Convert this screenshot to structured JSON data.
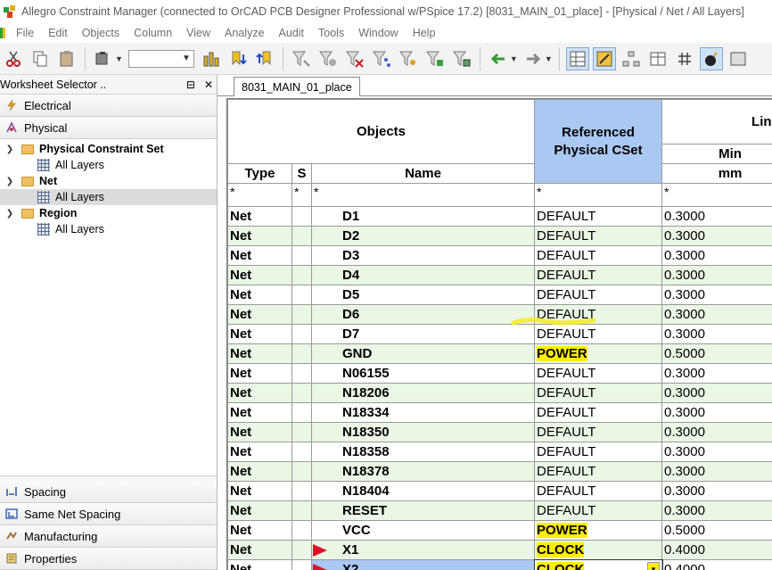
{
  "window": {
    "title": "Allegro Constraint Manager (connected to OrCAD PCB Designer Professional w/PSpice 17.2) [8031_MAIN_01_place] - [Physical / Net / All Layers]"
  },
  "menu": [
    "File",
    "Edit",
    "Objects",
    "Column",
    "View",
    "Analyze",
    "Audit",
    "Tools",
    "Window",
    "Help"
  ],
  "worksheet_selector": {
    "title": "Worksheet Selector ..",
    "pin_glyph": "⊟",
    "close_glyph": "✕",
    "top_categories": [
      {
        "label": "Electrical",
        "icon": "lightning-icon"
      },
      {
        "label": "Physical",
        "icon": "physical-icon"
      }
    ],
    "tree": [
      {
        "label": "Physical Constraint Set",
        "type": "folder",
        "level": 0
      },
      {
        "label": "All Layers",
        "type": "worksheet",
        "level": 1
      },
      {
        "label": "Net",
        "type": "folder",
        "level": 0
      },
      {
        "label": "All Layers",
        "type": "worksheet",
        "level": 1,
        "selected": true
      },
      {
        "label": "Region",
        "type": "folder",
        "level": 0
      },
      {
        "label": "All Layers",
        "type": "worksheet",
        "level": 1
      }
    ],
    "bottom_categories": [
      {
        "label": "Spacing",
        "icon": "spacing-icon"
      },
      {
        "label": "Same Net Spacing",
        "icon": "same-net-spacing-icon"
      },
      {
        "label": "Manufacturing",
        "icon": "manufacturing-icon"
      },
      {
        "label": "Properties",
        "icon": "properties-icon"
      }
    ]
  },
  "tab": {
    "label": "8031_MAIN_01_place"
  },
  "grid": {
    "header": {
      "objects": "Objects",
      "referenced": "Referenced Physical CSet",
      "line_group": "Lin",
      "min": "Min",
      "unit": "mm",
      "type": "Type",
      "s": "S",
      "name": "Name"
    },
    "filter": {
      "type": "*",
      "s": "*",
      "name": "*",
      "cset": "*",
      "min": "*"
    },
    "rows": [
      {
        "type": "Net",
        "name": "D1",
        "cset": "DEFAULT",
        "min": "0.3000"
      },
      {
        "type": "Net",
        "name": "D2",
        "cset": "DEFAULT",
        "min": "0.3000"
      },
      {
        "type": "Net",
        "name": "D3",
        "cset": "DEFAULT",
        "min": "0.3000"
      },
      {
        "type": "Net",
        "name": "D4",
        "cset": "DEFAULT",
        "min": "0.3000"
      },
      {
        "type": "Net",
        "name": "D5",
        "cset": "DEFAULT",
        "min": "0.3000"
      },
      {
        "type": "Net",
        "name": "D6",
        "cset": "DEFAULT",
        "min": "0.3000"
      },
      {
        "type": "Net",
        "name": "D7",
        "cset": "DEFAULT",
        "min": "0.3000"
      },
      {
        "type": "Net",
        "name": "GND",
        "cset": "POWER",
        "min": "0.5000",
        "highlight": true
      },
      {
        "type": "Net",
        "name": "N06155",
        "cset": "DEFAULT",
        "min": "0.3000"
      },
      {
        "type": "Net",
        "name": "N18206",
        "cset": "DEFAULT",
        "min": "0.3000"
      },
      {
        "type": "Net",
        "name": "N18334",
        "cset": "DEFAULT",
        "min": "0.3000"
      },
      {
        "type": "Net",
        "name": "N18350",
        "cset": "DEFAULT",
        "min": "0.3000"
      },
      {
        "type": "Net",
        "name": "N18358",
        "cset": "DEFAULT",
        "min": "0.3000"
      },
      {
        "type": "Net",
        "name": "N18378",
        "cset": "DEFAULT",
        "min": "0.3000"
      },
      {
        "type": "Net",
        "name": "N18404",
        "cset": "DEFAULT",
        "min": "0.3000"
      },
      {
        "type": "Net",
        "name": "RESET",
        "cset": "DEFAULT",
        "min": "0.3000"
      },
      {
        "type": "Net",
        "name": "VCC",
        "cset": "POWER",
        "min": "0.5000",
        "highlight": true
      },
      {
        "type": "Net",
        "name": "X1",
        "cset": "CLOCK",
        "min": "0.4000",
        "highlight": true,
        "flag": true
      },
      {
        "type": "Net",
        "name": "X2",
        "cset": "CLOCK",
        "min": "0.4000",
        "highlight": true,
        "flag": true,
        "selected": true,
        "editing": true
      }
    ]
  },
  "colors": {
    "row_alt": "#e9f7e4",
    "header_selected": "#a9c8f2",
    "highlight": "#ffee00",
    "flag": "#e0102a"
  }
}
